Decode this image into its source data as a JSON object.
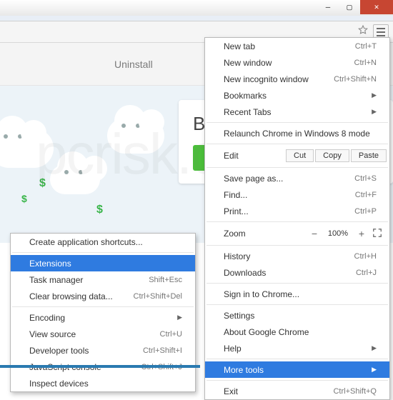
{
  "page": {
    "uninstall_label": "Uninstall",
    "hero_title": "Bro",
    "watermark": "pcrisk.com"
  },
  "main_menu": {
    "new_tab": "New tab",
    "new_tab_sc": "Ctrl+T",
    "new_window": "New window",
    "new_window_sc": "Ctrl+N",
    "new_incognito": "New incognito window",
    "new_incognito_sc": "Ctrl+Shift+N",
    "bookmarks": "Bookmarks",
    "recent_tabs": "Recent Tabs",
    "relaunch": "Relaunch Chrome in Windows 8 mode",
    "edit": "Edit",
    "cut": "Cut",
    "copy": "Copy",
    "paste": "Paste",
    "save_page": "Save page as...",
    "save_page_sc": "Ctrl+S",
    "find": "Find...",
    "find_sc": "Ctrl+F",
    "print": "Print...",
    "print_sc": "Ctrl+P",
    "zoom": "Zoom",
    "zoom_val": "100%",
    "history": "History",
    "history_sc": "Ctrl+H",
    "downloads": "Downloads",
    "downloads_sc": "Ctrl+J",
    "sign_in": "Sign in to Chrome...",
    "settings": "Settings",
    "about": "About Google Chrome",
    "help": "Help",
    "more_tools": "More tools",
    "exit": "Exit",
    "exit_sc": "Ctrl+Shift+Q"
  },
  "sub_menu": {
    "create_shortcuts": "Create application shortcuts...",
    "extensions": "Extensions",
    "task_manager": "Task manager",
    "task_manager_sc": "Shift+Esc",
    "clear_data": "Clear browsing data...",
    "clear_data_sc": "Ctrl+Shift+Del",
    "encoding": "Encoding",
    "view_source": "View source",
    "view_source_sc": "Ctrl+U",
    "dev_tools": "Developer tools",
    "dev_tools_sc": "Ctrl+Shift+I",
    "js_console": "JavaScript console",
    "js_console_sc": "Ctrl+Shift+J",
    "inspect": "Inspect devices"
  }
}
